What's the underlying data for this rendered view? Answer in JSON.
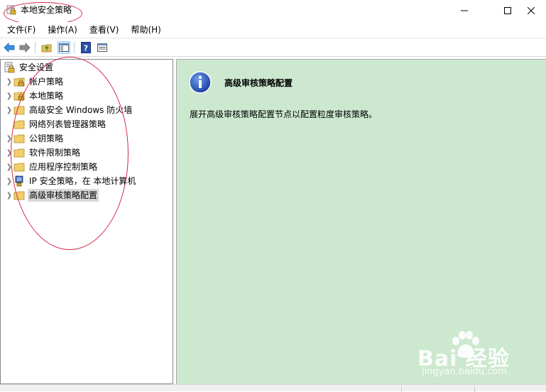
{
  "window": {
    "title": "本地安全策略",
    "icon": "security-policy-icon"
  },
  "menu": [
    {
      "label": "文件(F)"
    },
    {
      "label": "操作(A)"
    },
    {
      "label": "查看(V)"
    },
    {
      "label": "帮助(H)"
    }
  ],
  "toolbar": {
    "buttons": [
      "back-arrow-icon",
      "forward-arrow-icon",
      "up-folder-icon",
      "show-hide-tree-icon",
      "help-icon",
      "properties-icon"
    ]
  },
  "tree": {
    "root": "安全设置",
    "items": [
      {
        "label": "帐户策略",
        "icon": "folder-lock-icon"
      },
      {
        "label": "本地策略",
        "icon": "folder-lock-icon"
      },
      {
        "label": "高级安全 Windows 防火墙",
        "icon": "folder-icon"
      },
      {
        "label": "网络列表管理器策略",
        "icon": "folder-icon"
      },
      {
        "label": "公钥策略",
        "icon": "folder-icon"
      },
      {
        "label": "软件限制策略",
        "icon": "folder-icon"
      },
      {
        "label": "应用程序控制策略",
        "icon": "folder-icon"
      },
      {
        "label": "IP 安全策略，在 本地计算机",
        "icon": "ip-security-icon"
      },
      {
        "label": "高级审核策略配置",
        "icon": "folder-icon",
        "selected": true
      }
    ]
  },
  "content": {
    "title": "高级审核策略配置",
    "description": "展开高级审核策略配置节点以配置粒度审核策略。"
  },
  "watermark": {
    "main": "Bai 经验",
    "sub": "jingyan.baidu.com"
  },
  "colors": {
    "content_bg": "#cce8cf",
    "annotation": "#d6284a",
    "selection": "#d9d9d9"
  }
}
